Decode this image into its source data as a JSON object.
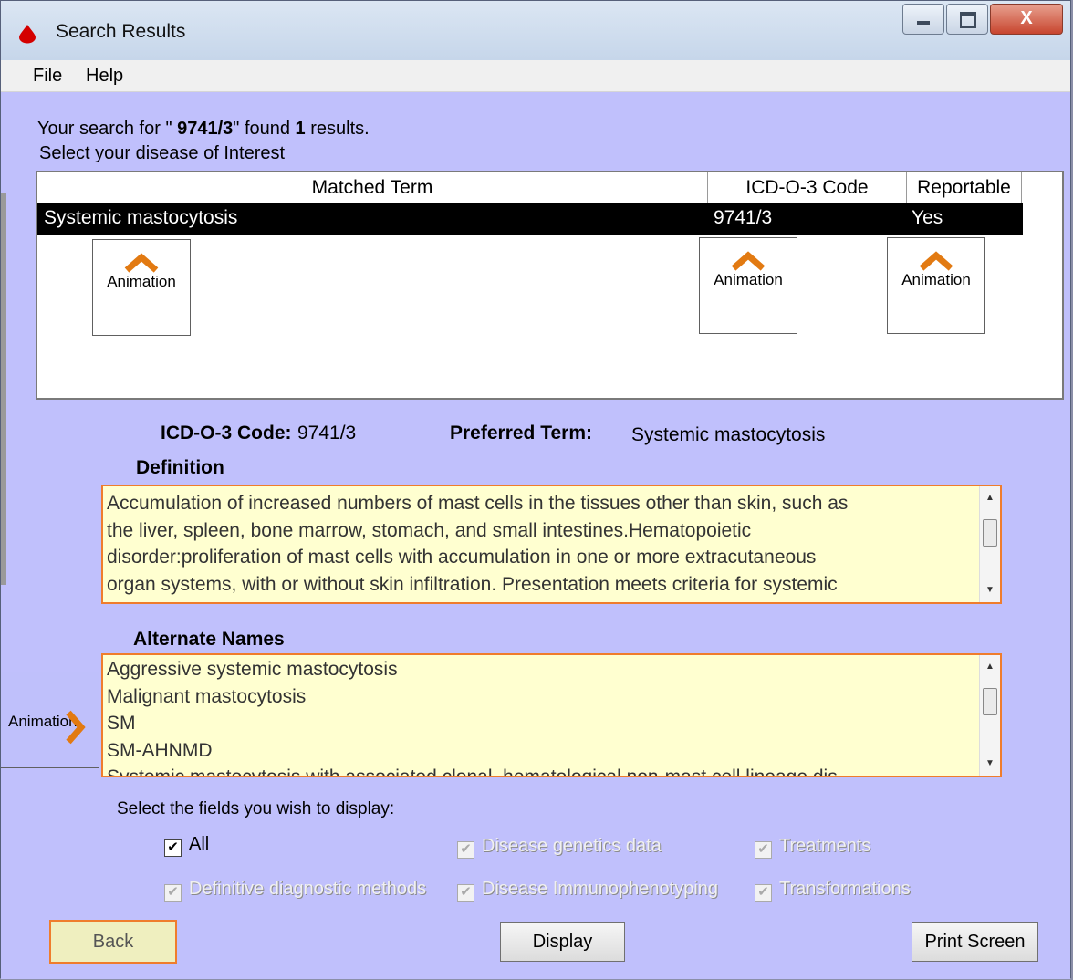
{
  "window": {
    "title": "Search Results",
    "close_label": "X"
  },
  "menu": [
    {
      "label": "File"
    },
    {
      "label": "Help"
    }
  ],
  "search_info": {
    "prefix": "Your search for \" ",
    "query": "9741/3",
    "middle": "\" found ",
    "count": "1",
    "suffix": " results.",
    "instruction": "Select your disease of Interest"
  },
  "results_table": {
    "columns": [
      "Matched Term",
      "ICD-O-3 Code",
      "Reportable"
    ],
    "rows": [
      {
        "term": "Systemic mastocytosis",
        "code": "9741/3",
        "reportable": "Yes"
      }
    ],
    "animation_label": "Animation"
  },
  "details": {
    "code_label": "ICD-O-3 Code:",
    "code_value": "9741/3",
    "preferred_label": "Preferred Term:",
    "preferred_value": "Systemic mastocytosis",
    "definition_label": "Definition",
    "definition_lines": [
      "Accumulation of increased numbers of mast cells in the tissues other than skin, such as",
      "the liver, spleen, bone marrow, stomach, and small intestines.Hematopoietic",
      "disorder:proliferation of mast cells with accumulation in one or more extracutaneous",
      "organ systems, with or without skin infiltration.   Presentation meets criteria for systemic"
    ],
    "alternate_label": "Alternate Names",
    "alternate_names": [
      "Aggressive systemic mastocytosis",
      "Malignant mastocytosis",
      "SM",
      "SM-AHNMD",
      "Systemic mastocytosis with associated clonal, hematological non-mast cell lineage dis"
    ]
  },
  "fields": {
    "prompt": "Select the fields you wish to display:",
    "options": [
      {
        "label": "All",
        "checked": true,
        "enabled": true
      },
      {
        "label": "Disease genetics data",
        "checked": true,
        "enabled": false
      },
      {
        "label": "Treatments",
        "checked": true,
        "enabled": false
      },
      {
        "label": "Definitive diagnostic methods",
        "checked": true,
        "enabled": false
      },
      {
        "label": "Disease Immunophenotyping",
        "checked": true,
        "enabled": false
      },
      {
        "label": "Transformations",
        "checked": true,
        "enabled": false
      }
    ]
  },
  "buttons": {
    "back": "Back",
    "display": "Display",
    "print": "Print Screen"
  },
  "colors": {
    "accent_orange": "#ef7d2c",
    "background": "#c0c0fc",
    "textbox_bg": "#ffffd0",
    "selected_row": "#000000"
  }
}
